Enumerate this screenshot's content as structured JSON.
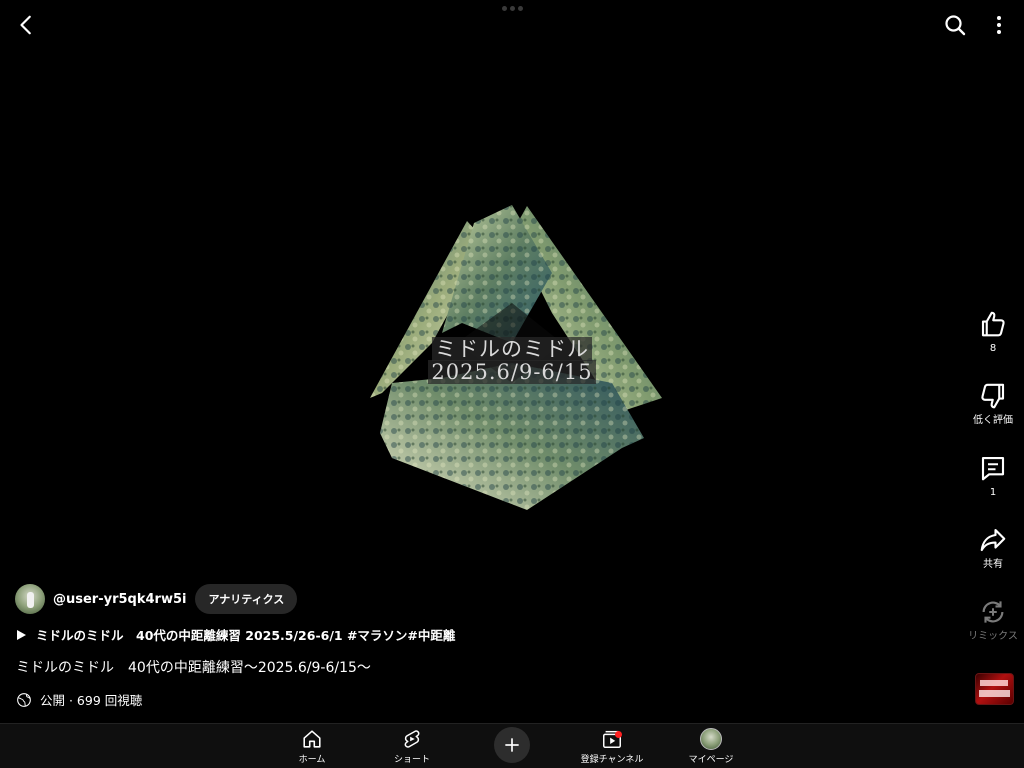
{
  "top_bar": {
    "back_icon": "chevron-left-icon",
    "search_icon": "search-icon",
    "more_icon": "more-vert-icon"
  },
  "video": {
    "overlay_line1": "ミドルのミドル",
    "overlay_line2": "2025.6/9-6/15"
  },
  "actions": {
    "like_count": "8",
    "dislike_label": "低く評価",
    "comment_count": "1",
    "share_label": "共有",
    "remix_label": "リミックス"
  },
  "meta": {
    "channel_handle": "@user-yr5qk4rw5i",
    "analytics_label": "アナリティクス",
    "related_video": "ミドルのミドル　40代の中距離練習 2025.5/26-6/1 #マラソン#中距離",
    "title": "ミドルのミドル　40代の中距離練習〜2025.6/9-6/15〜",
    "privacy_views": "公開 · 699 回視聴"
  },
  "bottom_nav": {
    "home": "ホーム",
    "shorts": "ショート",
    "subscriptions": "登録チャンネル",
    "my_page": "マイページ"
  },
  "colors": {
    "background": "#000000",
    "nav_background": "#0f0f0f",
    "notification_dot": "#ff2020",
    "chip_background": "#272727"
  }
}
